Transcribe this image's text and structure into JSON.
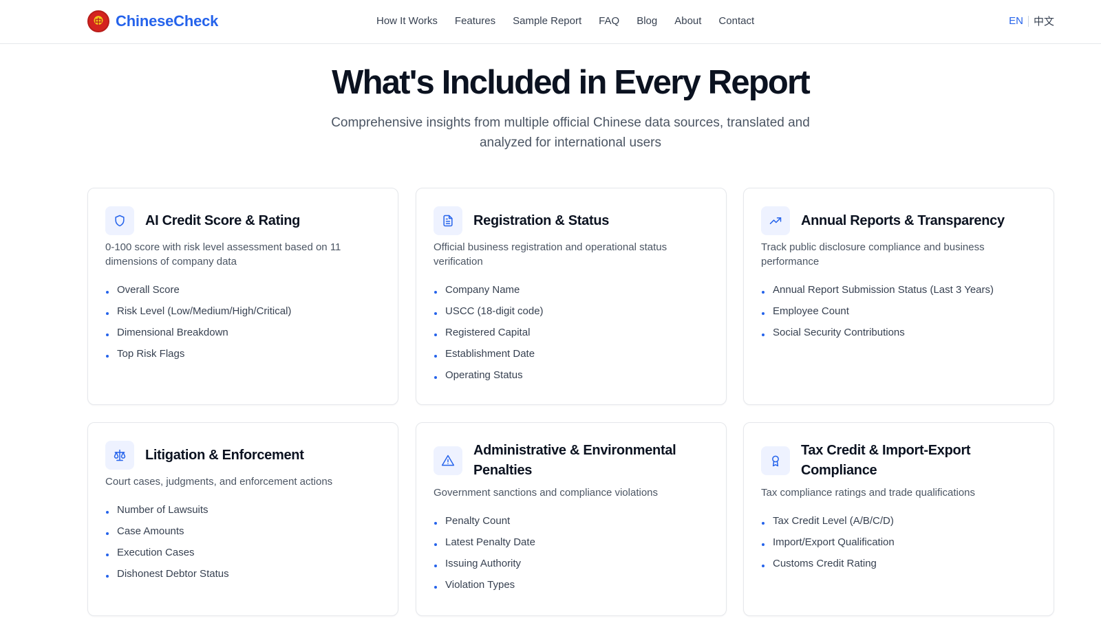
{
  "brand": {
    "name": "ChineseCheck",
    "emblem_char": "中",
    "accent_color": "#2563eb"
  },
  "nav": {
    "items": [
      "How It Works",
      "Features",
      "Sample Report",
      "FAQ",
      "Blog",
      "About",
      "Contact"
    ]
  },
  "lang": {
    "en": "EN",
    "zh": "中文"
  },
  "hero": {
    "title": "What's Included in Every Report",
    "subtitle": "Comprehensive insights from multiple official Chinese data sources, translated and analyzed for international users"
  },
  "cards": [
    {
      "icon": "shield-icon",
      "title": "AI Credit Score & Rating",
      "desc": "0-100 score with risk level assessment based on 11 dimensions of company data",
      "items": [
        "Overall Score",
        "Risk Level (Low/Medium/High/Critical)",
        "Dimensional Breakdown",
        "Top Risk Flags"
      ]
    },
    {
      "icon": "document-icon",
      "title": "Registration & Status",
      "desc": "Official business registration and operational status verification",
      "items": [
        "Company Name",
        "USCC (18-digit code)",
        "Registered Capital",
        "Establishment Date",
        "Operating Status"
      ]
    },
    {
      "icon": "trending-up-icon",
      "title": "Annual Reports & Transparency",
      "desc": "Track public disclosure compliance and business performance",
      "items": [
        "Annual Report Submission Status (Last 3 Years)",
        "Employee Count",
        "Social Security Contributions"
      ]
    },
    {
      "icon": "scale-icon",
      "title": "Litigation & Enforcement",
      "desc": "Court cases, judgments, and enforcement actions",
      "items": [
        "Number of Lawsuits",
        "Case Amounts",
        "Execution Cases",
        "Dishonest Debtor Status"
      ]
    },
    {
      "icon": "warning-icon",
      "title": "Administrative & Environmental Penalties",
      "desc": "Government sanctions and compliance violations",
      "items": [
        "Penalty Count",
        "Latest Penalty Date",
        "Issuing Authority",
        "Violation Types"
      ]
    },
    {
      "icon": "award-icon",
      "title": "Tax Credit & Import-Export Compliance",
      "desc": "Tax compliance ratings and trade qualifications",
      "items": [
        "Tax Credit Level (A/B/C/D)",
        "Import/Export Qualification",
        "Customs Credit Rating"
      ]
    }
  ]
}
